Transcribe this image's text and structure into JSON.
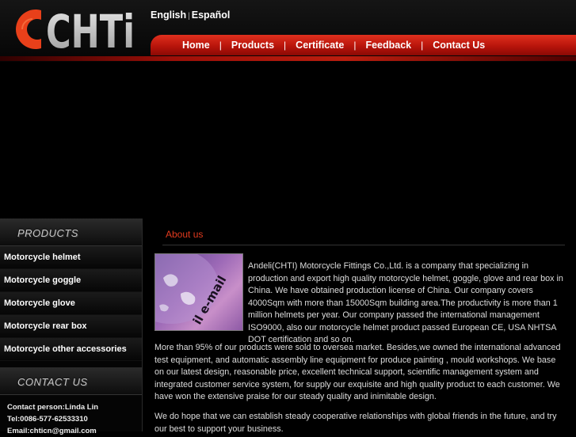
{
  "header": {
    "logo_text": "CHTi",
    "languages": [
      "English",
      "Español"
    ],
    "nav": [
      "Home",
      "Products",
      "Certificate",
      "Feedback",
      "Contact Us"
    ]
  },
  "sidebar": {
    "products_title": "PRODUCTS",
    "products": [
      "Motorcycle helmet",
      "Motorcycle goggle",
      "Motorcycle glove",
      "Motorcycle rear box",
      "Motorcycle other accessories"
    ],
    "contact_title": "CONTACT US",
    "contact_lines": [
      "Contact person:Linda Lin",
      "Tel:0086-577-62533310",
      "Email:chticn@gmail.com"
    ]
  },
  "main": {
    "title": "About us",
    "photo_text": "il e-mail",
    "paragraph1": "Andeli(CHTI) Motorcycle Fittings Co.,Ltd. is a company that specializing in production and export high quality motorcycle helmet, goggle, glove and rear box in China. We have obtained production license of China. Our company covers 4000Sqm with more than 15000Sqm building area.The productivity is more than 1 million helmets per year. Our company passed the international management ISO9000, also our motorcycle helmet product passed European CE, USA NHTSA DOT certification and so on.",
    "paragraph2": "More than 95% of our products were sold to oversea market. Besides,we owned the international advanced test equipment, and automatic assembly line equipment for produce painting , mould workshops. We base on our latest design, reasonable price, excellent technical support, scientific management system and integrated customer service system, for supply our exquisite and high quality product to each customer. We have won the extensive praise for our steady quality and inimitable design.",
    "paragraph3": "We do hope that we can establish steady cooperative relationships with global friends in the future, and try our best to support your business."
  },
  "colors": {
    "accent": "#d0200f",
    "title": "#e23a1e"
  }
}
